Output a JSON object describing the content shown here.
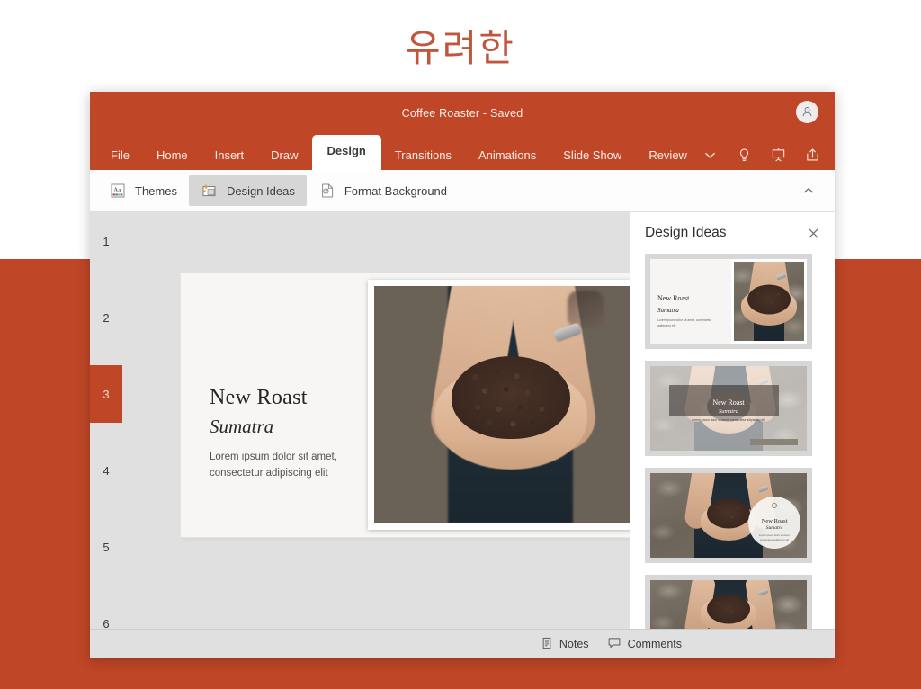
{
  "headline": "유려한",
  "colors": {
    "brand_orange": "#bf4627",
    "headline_text": "#c0563c",
    "page_background_top": "#ffffff",
    "page_background_bottom": "#bf4627",
    "active_tab_background": "#ffffff",
    "selected_slide_number": "#bf4627"
  },
  "window": {
    "title": "Coffee Roaster - Saved",
    "avatar_icon": "account-person-icon"
  },
  "ribbon": {
    "tabs": [
      {
        "label": "File",
        "active": false
      },
      {
        "label": "Home",
        "active": false
      },
      {
        "label": "Insert",
        "active": false
      },
      {
        "label": "Draw",
        "active": false
      },
      {
        "label": "Design",
        "active": true
      },
      {
        "label": "Transitions",
        "active": false
      },
      {
        "label": "Animations",
        "active": false
      },
      {
        "label": "Slide Show",
        "active": false
      },
      {
        "label": "Review",
        "active": false
      }
    ],
    "icons": [
      {
        "name": "chevron-down-icon",
        "dim": false
      },
      {
        "name": "lightbulb-tellme-icon",
        "dim": false
      },
      {
        "name": "present-slideshow-icon",
        "dim": false
      },
      {
        "name": "share-icon",
        "dim": false
      },
      {
        "name": "undo-icon",
        "dim": false
      },
      {
        "name": "redo-icon",
        "dim": true
      }
    ]
  },
  "toolbar": {
    "items": [
      {
        "label": "Themes",
        "icon": "themes-icon",
        "active": false
      },
      {
        "label": "Design Ideas",
        "icon": "design-ideas-icon",
        "active": true
      },
      {
        "label": "Format Background",
        "icon": "format-background-icon",
        "active": false
      }
    ],
    "collapse_icon": "chevron-up-icon"
  },
  "slide_rail": {
    "numbers": [
      "1",
      "2",
      "3",
      "4",
      "5",
      "6"
    ],
    "selected": "3"
  },
  "slide": {
    "title": "New Roast",
    "subtitle": "Sumatra",
    "body": "Lorem ipsum dolor sit amet, consectetur adipiscing elit",
    "picture_alt": "hands-holding-coffee-beans"
  },
  "design_ideas": {
    "title": "Design Ideas",
    "close_icon": "close-icon",
    "items": [
      {
        "layout": "split-text-left-image-right",
        "title": "New Roast",
        "subtitle": "Sumatra",
        "body": "Lorem ipsum dolor sit amet, consectetur adipiscing elit"
      },
      {
        "layout": "full-image-dark-banner",
        "title": "New Roast",
        "subtitle": "Sumatra",
        "body": "Lorem ipsum dolor sit amet, consectetur adipiscing elit"
      },
      {
        "layout": "full-image-circle-badge",
        "title": "New Roast",
        "subtitle": "Sumatra",
        "body": "Lorem ipsum dolor sit amet, consectetur adipiscing elit"
      },
      {
        "layout": "cropped-band-image",
        "title": "",
        "subtitle": "",
        "body": ""
      }
    ]
  },
  "statusbar": {
    "notes_label": "Notes",
    "notes_icon": "notes-icon",
    "comments_label": "Comments",
    "comments_icon": "comment-bubble-icon"
  }
}
